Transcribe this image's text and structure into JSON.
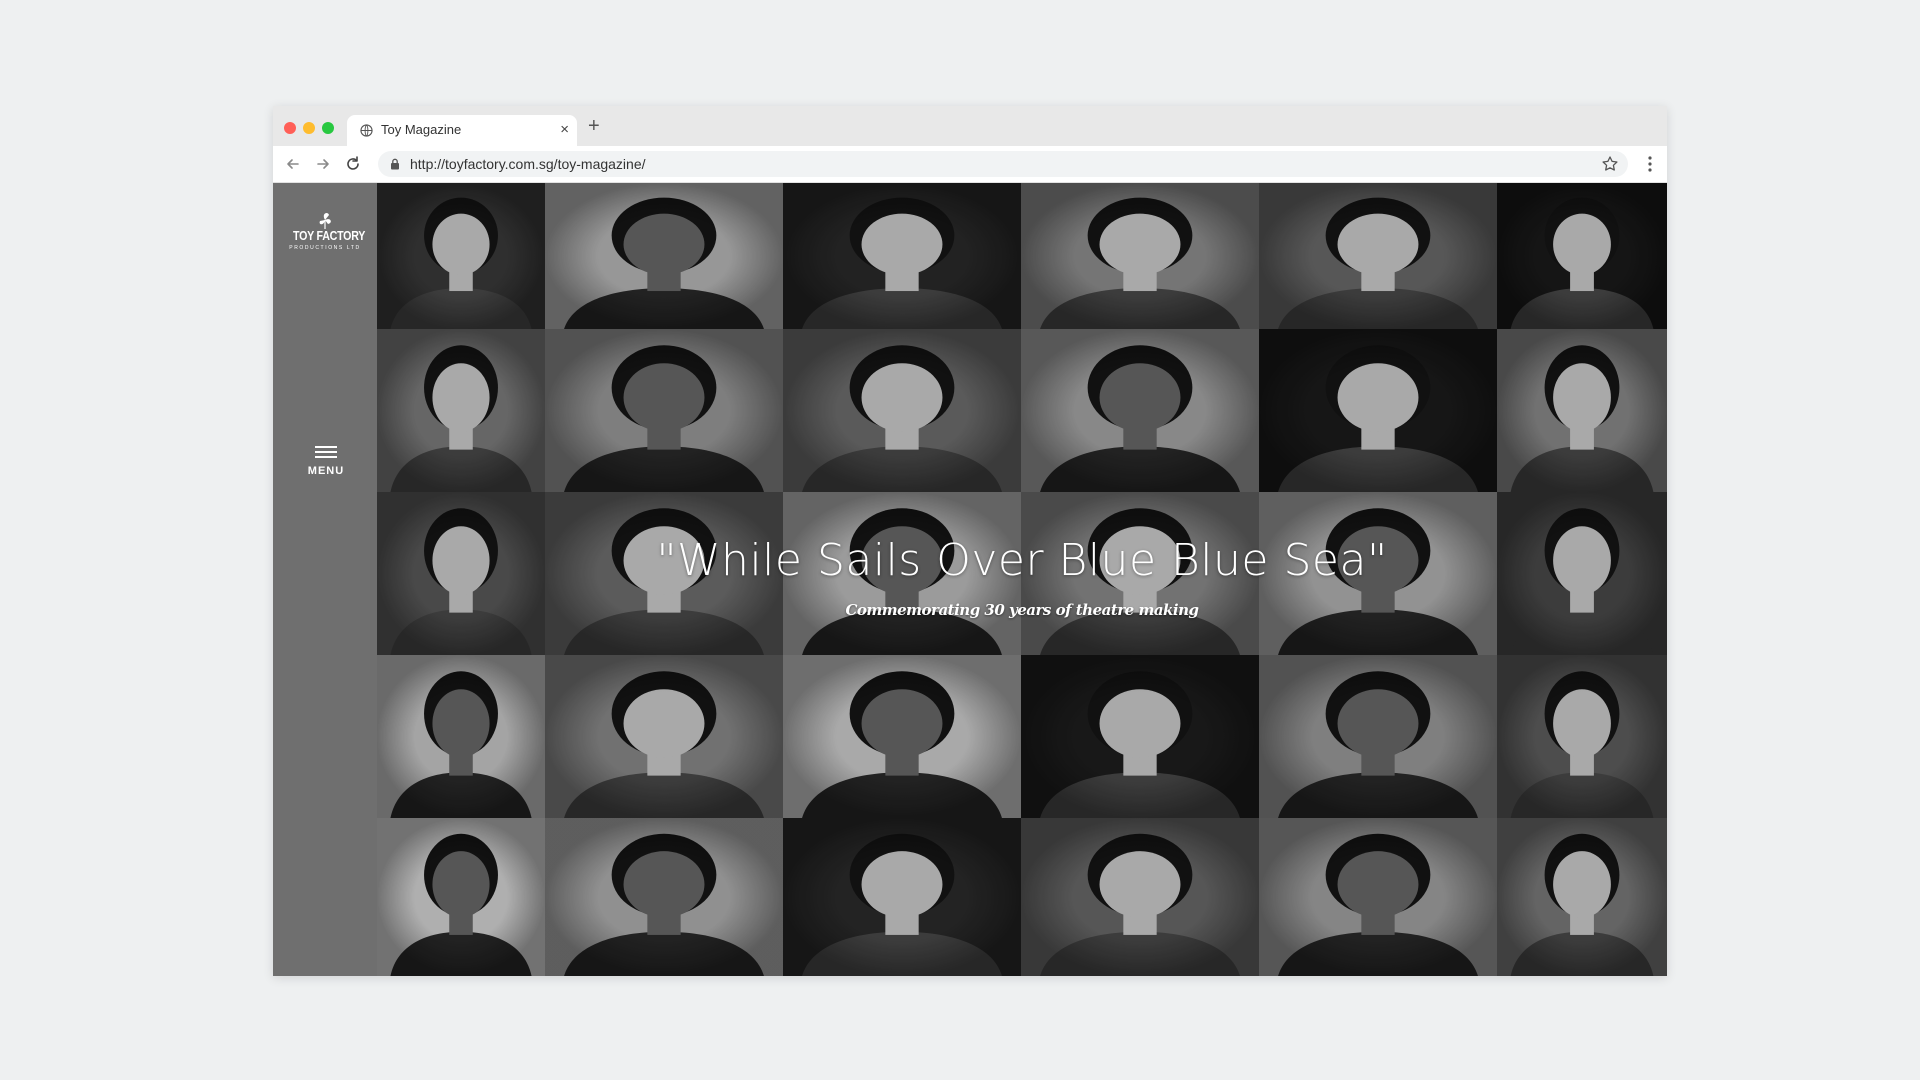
{
  "browser": {
    "tab_title": "Toy Magazine",
    "tab_close": "×",
    "new_tab": "+",
    "url": "http://toyfactory.com.sg/toy-magazine/",
    "traffic_colors": [
      "#ff5f57",
      "#febc2e",
      "#28c840"
    ]
  },
  "sidebar": {
    "logo_name": "TOY FACTORY",
    "logo_sub": "PRODUCTIONS LTD",
    "menu_label": "MENU"
  },
  "hero": {
    "headline": "\"While Sails Over Blue Blue Sea\"",
    "tagline": "Commemorating 30 years of theatre making"
  },
  "portrait_tones": [
    [
      "#3a3a3a",
      "#b9b9b9",
      "#2a2a2a",
      "#8f8f8f",
      "#6b6b6b",
      "#1a1a1a"
    ],
    [
      "#7d7d7d",
      "#9a9a9a",
      "#6e6e6e",
      "#a6a6a6",
      "#1c1c1c",
      "#8a8a8a"
    ],
    [
      "#5a5a5a",
      "#707070",
      "#bdbdbd",
      "#8c8c8c",
      "#b3b3b3",
      "#4a4a4a"
    ],
    [
      "#c8c8c8",
      "#8a8a8a",
      "#cfcfcf",
      "#1e1e1e",
      "#9b9b9b",
      "#5e5e5e"
    ],
    [
      "#d6d6d6",
      "#b0b0b0",
      "#2b2b2b",
      "#6a6a6a",
      "#a3a3a3",
      "#7a7a7a"
    ]
  ]
}
